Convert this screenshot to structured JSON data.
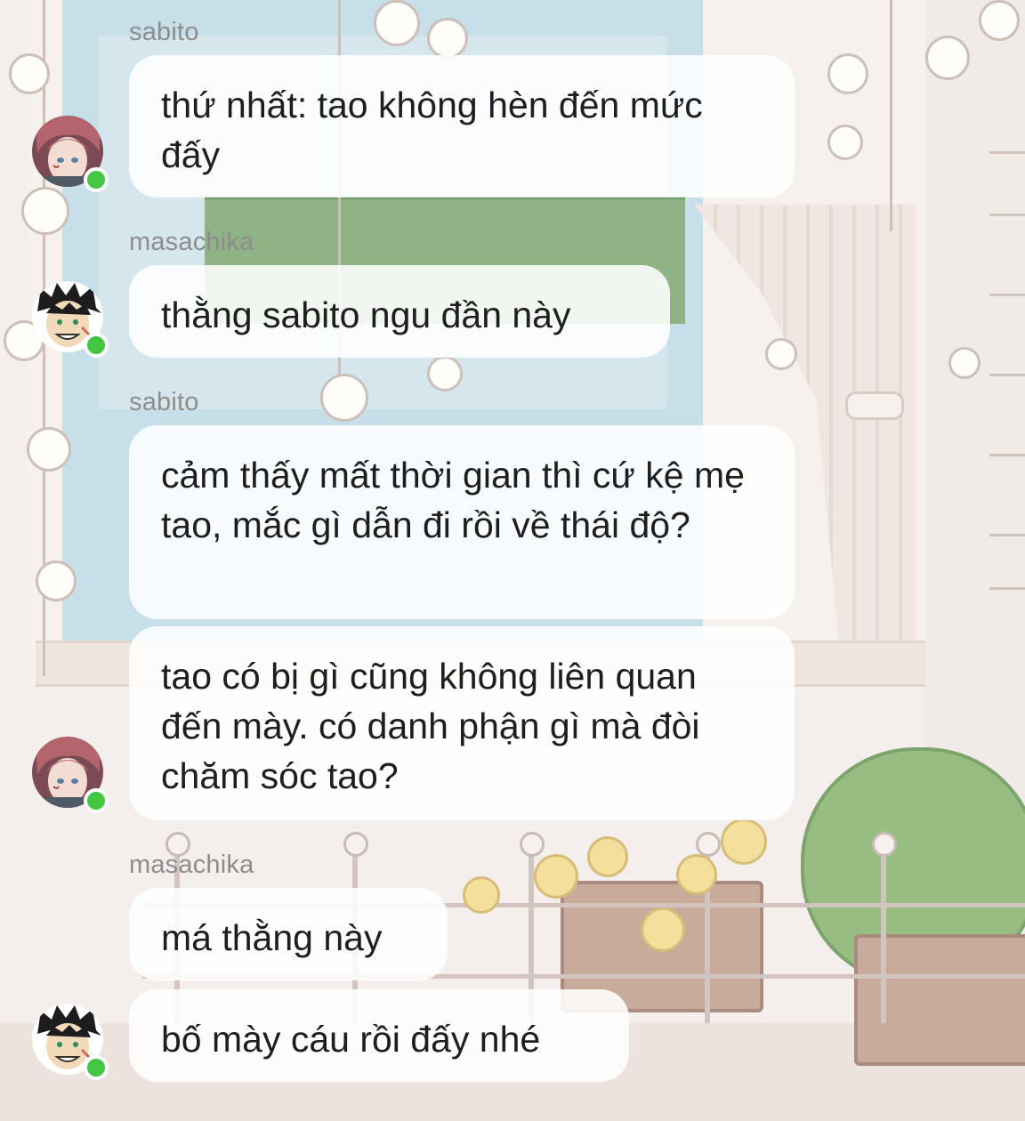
{
  "messages": [
    {
      "username": "sabito",
      "text": "thứ nhất: tao không hèn đến mức đấy",
      "avatar": "sabito-avatar",
      "online": true
    },
    {
      "username": "masachika",
      "text": "thằng sabito ngu đần này",
      "avatar": "masachika-avatar",
      "online": true
    },
    {
      "username": "sabito",
      "text": "cảm thấy mất thời gian thì cứ kệ mẹ tao, mắc gì dẫn đi rồi về thái độ?",
      "avatar": null,
      "online": false
    },
    {
      "username": null,
      "text": "tao có bị gì cũng không liên quan đến mày. có danh phận gì mà đòi chăm sóc tao?",
      "avatar": "sabito-avatar",
      "online": true
    },
    {
      "username": "masachika",
      "text": "má thằng này",
      "avatar": null,
      "online": false
    },
    {
      "username": null,
      "text": "bố mày cáu rồi đấy nhé",
      "avatar": "masachika-avatar",
      "online": true
    }
  ],
  "colors": {
    "online_indicator": "#43c743",
    "bubble_background": "#ffffff",
    "username_text": "#8d8d8d",
    "message_text": "#1e1e1e"
  }
}
